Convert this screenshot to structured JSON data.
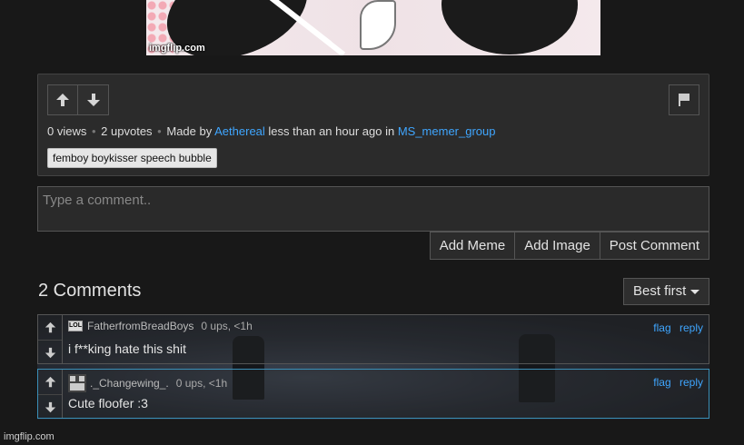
{
  "meme": {
    "watermark": "imgflip.com"
  },
  "post": {
    "views": "0 views",
    "upvotes": "2 upvotes",
    "made_by_prefix": "Made by",
    "author": "Aethereal",
    "time_text": "less than an hour ago in",
    "stream": "MS_memer_group",
    "tag": "femboy boykisser speech bubble"
  },
  "composer": {
    "placeholder": "Type a comment..",
    "buttons": [
      "Add Meme",
      "Add Image",
      "Post Comment"
    ]
  },
  "comments_section": {
    "title": "2 Comments",
    "sort_label": "Best first",
    "comments": [
      {
        "avatar_text": "LOL",
        "username": "FatherfromBreadBoys",
        "meta": "0 ups, <1h",
        "text": "i f**king hate this shit",
        "flag": "flag",
        "reply": "reply"
      },
      {
        "username": "._Changewing_.",
        "meta": "0 ups, <1h",
        "text": "Cute floofer :3",
        "flag": "flag",
        "reply": "reply"
      }
    ]
  },
  "footer": {
    "watermark": "imgflip.com"
  },
  "colors": {
    "link": "#3fa6ff",
    "background": "#181818",
    "panel": "#2b2b2b",
    "selected_comment_border": "#3a8fb7"
  }
}
